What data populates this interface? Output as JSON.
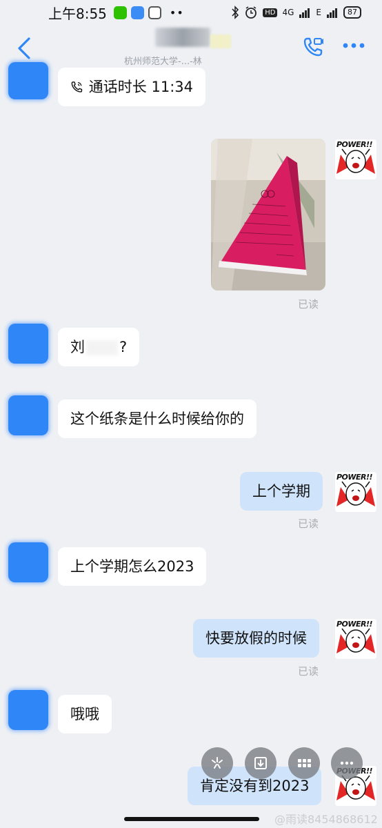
{
  "status_bar": {
    "time": "上午8:55",
    "extra": "••",
    "network": "4G",
    "network2": "E",
    "battery": "87",
    "hd": "HD"
  },
  "header": {
    "subtitle": "杭州师范大学-...-林"
  },
  "messages": {
    "call": "通话时长 11:34",
    "read1": "已读",
    "name_prefix": "刘",
    "name_suffix": "?",
    "question": "这个纸条是什么时候给你的",
    "reply1": "上个学期",
    "read2": "已读",
    "question2": "上个学期怎么2023",
    "reply2": "快要放假的时候",
    "read3": "已读",
    "oh": "哦哦",
    "reply3": "肯定没有到2023"
  },
  "sticker": {
    "text": "POWER!!"
  },
  "watermark": "@雨读8454868612",
  "colors": {
    "accent": "#2f86f6",
    "bubble_right": "#cfe4fb",
    "background": "#eef0f4"
  }
}
